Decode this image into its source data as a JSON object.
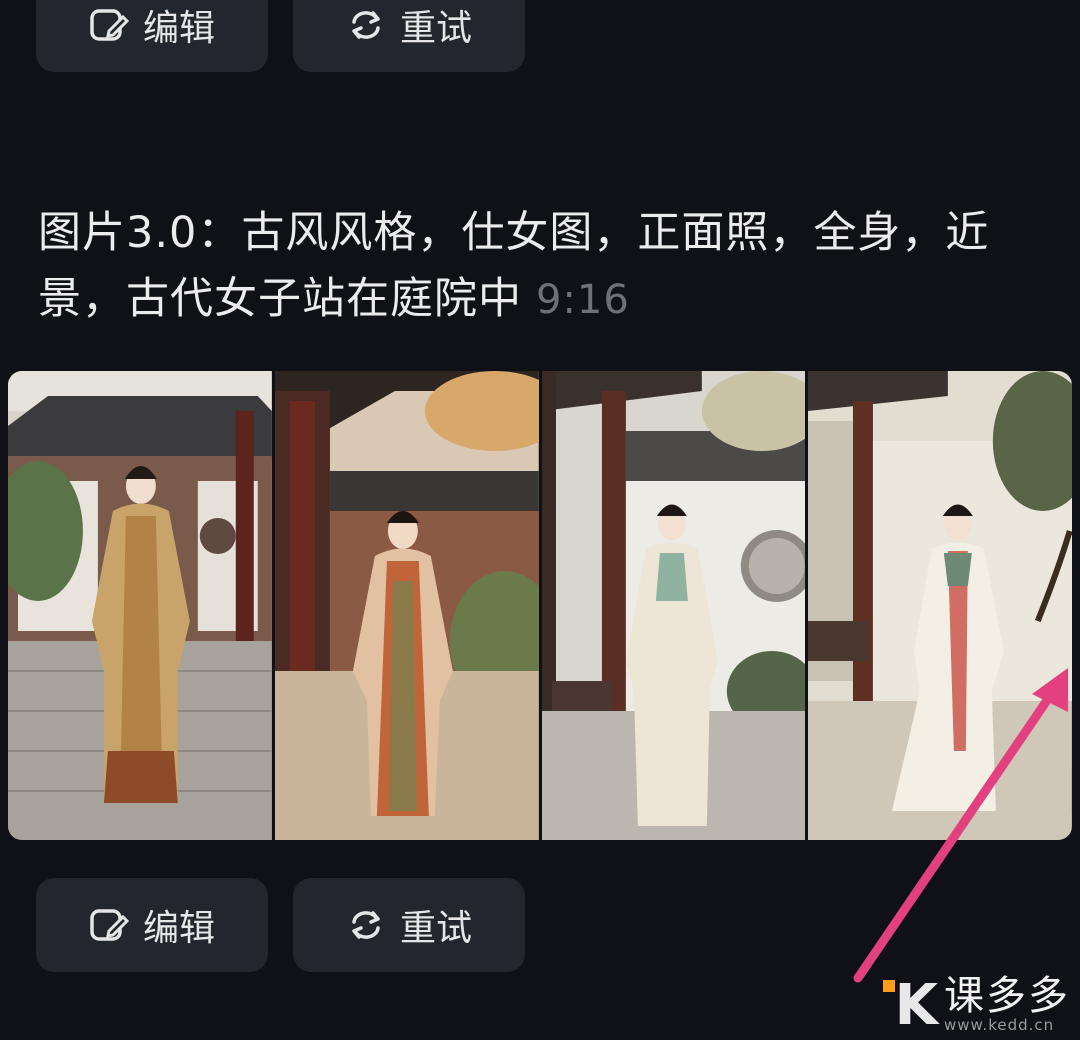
{
  "actions": {
    "edit_label": "编辑",
    "retry_label": "重试"
  },
  "message": {
    "prompt": "图片3.0：古风风格，仕女图，正面照，全身，近景，古代女子站在庭院中",
    "ratio": "9:16"
  },
  "gallery": {
    "count": 4,
    "images": [
      {
        "subject": "woman in gold hanfu in courtyard"
      },
      {
        "subject": "woman in orange hanfu by red pillars"
      },
      {
        "subject": "woman in white hanfu by pavilion"
      },
      {
        "subject": "woman in white robe by garden wall"
      }
    ]
  },
  "annotation": {
    "arrow_color": "#e2407e"
  },
  "watermark": {
    "logo": "K",
    "name": "课多多",
    "url": "www.kedd.cn"
  },
  "icons": [
    "edit-icon",
    "retry-icon"
  ]
}
